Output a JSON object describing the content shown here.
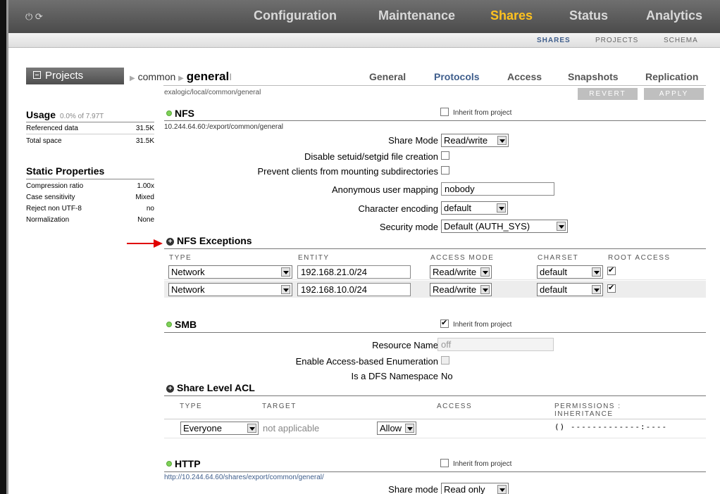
{
  "topnav": {
    "items": [
      {
        "label": "Configuration",
        "active": false
      },
      {
        "label": "Maintenance",
        "active": false
      },
      {
        "label": "Shares",
        "active": true
      },
      {
        "label": "Status",
        "active": false
      },
      {
        "label": "Analytics",
        "active": false
      }
    ]
  },
  "subnav": {
    "items": [
      {
        "label": "SHARES",
        "active": true
      },
      {
        "label": "PROJECTS",
        "active": false
      },
      {
        "label": "SCHEMA",
        "active": false
      }
    ]
  },
  "projects_button": "Projects",
  "breadcrumb": {
    "parent": "common",
    "current": "general"
  },
  "tabs": [
    {
      "label": "General",
      "active": false
    },
    {
      "label": "Protocols",
      "active": true
    },
    {
      "label": "Access",
      "active": false
    },
    {
      "label": "Snapshots",
      "active": false
    },
    {
      "label": "Replication",
      "active": false
    }
  ],
  "path": "exalogic/local/common/general",
  "buttons": {
    "revert": "REVERT",
    "apply": "APPLY"
  },
  "sidebar": {
    "usage_title": "Usage",
    "usage_pct": "0.0% of 7.97T",
    "usage_rows": [
      {
        "label": "Referenced data",
        "value": "31.5K"
      },
      {
        "label": "Total space",
        "value": "31.5K"
      }
    ],
    "static_title": "Static Properties",
    "static_rows": [
      {
        "label": "Compression ratio",
        "value": "1.00x"
      },
      {
        "label": "Case sensitivity",
        "value": "Mixed"
      },
      {
        "label": "Reject non UTF-8",
        "value": "no"
      },
      {
        "label": "Normalization",
        "value": "None"
      }
    ]
  },
  "nfs": {
    "title": "NFS",
    "inherit_label": "Inherit from project",
    "inherit_checked": false,
    "export_path": "10.244.64.60:/export/common/general",
    "share_mode_label": "Share Mode",
    "share_mode_value": "Read/write",
    "setuid_label": "Disable setuid/setgid file creation",
    "prevent_label": "Prevent clients from mounting subdirectories",
    "anon_label": "Anonymous user mapping",
    "anon_value": "nobody",
    "charenc_label": "Character encoding",
    "charenc_value": "default",
    "security_label": "Security mode",
    "security_value": "Default (AUTH_SYS)"
  },
  "nfs_exceptions": {
    "title": "NFS Exceptions",
    "headers": {
      "type": "TYPE",
      "entity": "ENTITY",
      "access": "ACCESS MODE",
      "charset": "CHARSET",
      "root": "ROOT ACCESS"
    },
    "rows": [
      {
        "type": "Network",
        "entity": "192.168.21.0/24",
        "access": "Read/write",
        "charset": "default",
        "root": true
      },
      {
        "type": "Network",
        "entity": "192.168.10.0/24",
        "access": "Read/write",
        "charset": "default",
        "root": true
      }
    ]
  },
  "smb": {
    "title": "SMB",
    "inherit_label": "Inherit from project",
    "inherit_checked": true,
    "resource_label": "Resource Name",
    "resource_value": "off",
    "abe_label": "Enable Access-based Enumeration",
    "dfs_label": "Is a DFS Namespace",
    "dfs_value": "No"
  },
  "acl": {
    "title": "Share Level ACL",
    "headers": {
      "type": "TYPE",
      "target": "TARGET",
      "access": "ACCESS",
      "perm": "PERMISSIONS :",
      "inherit": "INHERITANCE"
    },
    "row": {
      "type": "Everyone",
      "target": "not applicable",
      "access": "Allow",
      "perm": "()  -------------:----"
    }
  },
  "http": {
    "title": "HTTP",
    "inherit_label": "Inherit from project",
    "inherit_checked": false,
    "url": "http://10.244.64.60/shares/export/common/general/",
    "share_mode_label": "Share mode",
    "share_mode_value": "Read only"
  },
  "colors": {
    "accent": "#3f5e8c",
    "active_nav": "#ffc21f",
    "status_green": "#7ed157",
    "arrow_red": "#e00000"
  }
}
